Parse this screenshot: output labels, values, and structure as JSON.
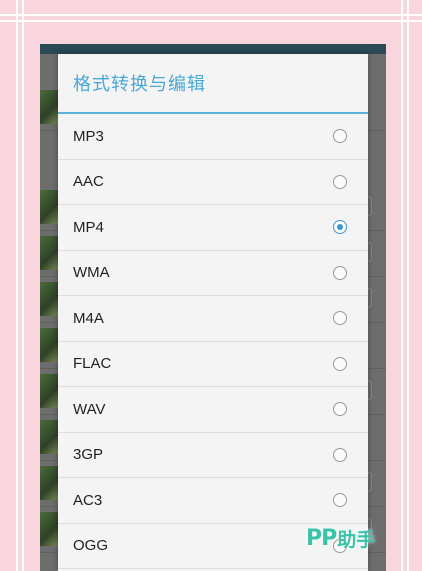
{
  "dialog": {
    "title": "格式转换与编辑",
    "options": [
      {
        "label": "MP3",
        "checked": false
      },
      {
        "label": "AAC",
        "checked": false
      },
      {
        "label": "MP4",
        "checked": true
      },
      {
        "label": "WMA",
        "checked": false
      },
      {
        "label": "M4A",
        "checked": false
      },
      {
        "label": "FLAC",
        "checked": false
      },
      {
        "label": "WAV",
        "checked": false
      },
      {
        "label": "3GP",
        "checked": false
      },
      {
        "label": "AC3",
        "checked": false
      },
      {
        "label": "OGG",
        "checked": false
      }
    ]
  },
  "watermark": {
    "brand": "PP",
    "text": "助手"
  },
  "colors": {
    "accent": "#4aa8d6",
    "radio_checked": "#3f98cf",
    "background_pink": "#f9d5de",
    "watermark": "#39c3a8"
  }
}
